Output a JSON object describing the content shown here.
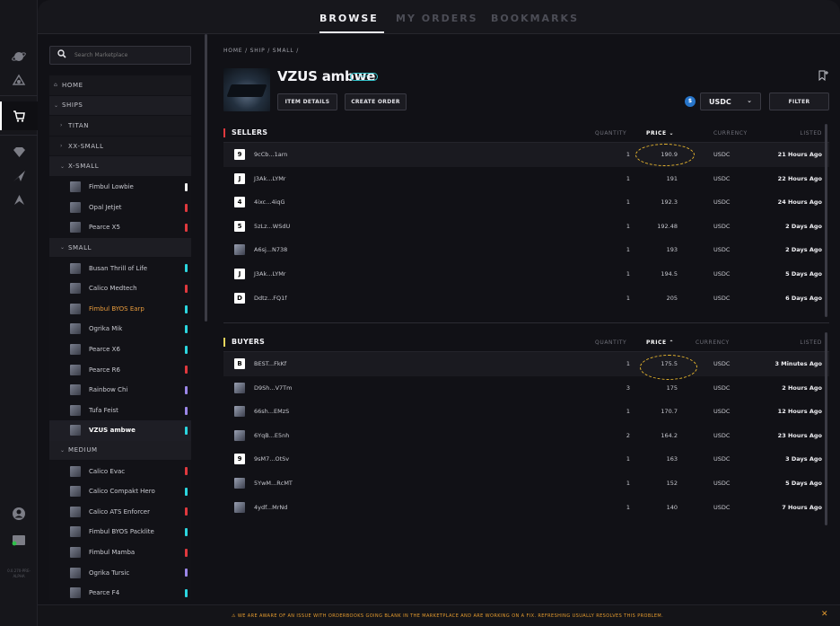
{
  "nav_tabs": [
    "BROWSE",
    "MY ORDERS",
    "BOOKMARKS"
  ],
  "search": {
    "placeholder": "Search Marketplace"
  },
  "rail": {
    "icons": [
      "planet-icon",
      "radar-icon",
      "cart-icon",
      "diamond-icon",
      "ship-icon",
      "logo-icon",
      "profile-icon",
      "wallet-icon"
    ],
    "version": "0.0.270-PRE-ALPHA"
  },
  "sidebar": {
    "home": "HOME",
    "ships": "SHIPS",
    "titan": "TITAN",
    "xx_small": "XX-SMALL",
    "x_small": "X-SMALL",
    "x_small_items": [
      {
        "label": "Fimbul Lowbie",
        "color": "#f2f2f2"
      },
      {
        "label": "Opal Jetjet",
        "color": "#e0393e"
      },
      {
        "label": "Pearce X5",
        "color": "#e0393e"
      }
    ],
    "small": "SMALL",
    "small_items": [
      {
        "label": "Busan Thrill of Life",
        "color": "#2bd6df"
      },
      {
        "label": "Calico Medtech",
        "color": "#e0393e"
      },
      {
        "label": "Fimbul BYOS Earp",
        "color": "#2bd6df"
      },
      {
        "label": "Ogrika Mik",
        "color": "#2bd6df"
      },
      {
        "label": "Pearce X6",
        "color": "#2bd6df"
      },
      {
        "label": "Pearce R6",
        "color": "#e0393e"
      },
      {
        "label": "Rainbow Chi",
        "color": "#9b86e8"
      },
      {
        "label": "Tufa Feist",
        "color": "#9b86e8"
      },
      {
        "label": "VZUS ambwe",
        "color": "#2bd6df"
      }
    ],
    "medium": "MEDIUM",
    "medium_items": [
      {
        "label": "Calico Evac",
        "color": "#e0393e"
      },
      {
        "label": "Calico Compakt Hero",
        "color": "#2bd6df"
      },
      {
        "label": "Calico ATS Enforcer",
        "color": "#e0393e"
      },
      {
        "label": "Fimbul BYOS Packlite",
        "color": "#2bd6df"
      },
      {
        "label": "Fimbul Mamba",
        "color": "#e0393e"
      },
      {
        "label": "Ogrika Tursic",
        "color": "#9b86e8"
      },
      {
        "label": "Pearce F4",
        "color": "#2bd6df"
      }
    ]
  },
  "main": {
    "breadcrumb": "HOME / SHIP / SMALL /",
    "title": "VZUS ambwe",
    "rarity": "RARE",
    "item_details": "ITEM DETAILS",
    "create_order": "CREATE ORDER",
    "currency": "USDC",
    "filter": "FILTER"
  },
  "columns": {
    "quantity": "QUANTITY",
    "price": "PRICE",
    "currency": "CURRENCY",
    "listed": "LISTED"
  },
  "sellers": {
    "title": "SELLERS",
    "rows": [
      {
        "avatar": "9",
        "name": "9cCb...1arn",
        "qty": "1",
        "price": "190.9",
        "cur": "USDC",
        "time": "21 Hours Ago"
      },
      {
        "avatar": "J",
        "name": "J3Ak...LYMr",
        "qty": "1",
        "price": "191",
        "cur": "USDC",
        "time": "22 Hours Ago"
      },
      {
        "avatar": "4",
        "name": "4ixc...4iqG",
        "qty": "1",
        "price": "192.3",
        "cur": "USDC",
        "time": "24 Hours Ago"
      },
      {
        "avatar": "5",
        "name": "5zLz...WSdU",
        "qty": "1",
        "price": "192.48",
        "cur": "USDC",
        "time": "2 Days Ago"
      },
      {
        "avatar": "",
        "name": "A6sj...N738",
        "qty": "1",
        "price": "193",
        "cur": "USDC",
        "time": "2 Days Ago"
      },
      {
        "avatar": "J",
        "name": "J3Ak...LYMr",
        "qty": "1",
        "price": "194.5",
        "cur": "USDC",
        "time": "5 Days Ago"
      },
      {
        "avatar": "D",
        "name": "Ddtz...FQ1f",
        "qty": "1",
        "price": "205",
        "cur": "USDC",
        "time": "6 Days Ago"
      }
    ]
  },
  "buyers": {
    "title": "BUYERS",
    "rows": [
      {
        "avatar": "B",
        "name": "BEST...FkKf",
        "qty": "1",
        "price": "175.5",
        "cur": "USDC",
        "time": "3 Minutes Ago"
      },
      {
        "avatar": "",
        "name": "D9Sh...V7Tm",
        "qty": "3",
        "price": "175",
        "cur": "USDC",
        "time": "2 Hours Ago"
      },
      {
        "avatar": "",
        "name": "66sh...EMzS",
        "qty": "1",
        "price": "170.7",
        "cur": "USDC",
        "time": "12 Hours Ago"
      },
      {
        "avatar": "",
        "name": "6YqB...E5nh",
        "qty": "2",
        "price": "164.2",
        "cur": "USDC",
        "time": "23 Hours Ago"
      },
      {
        "avatar": "9",
        "name": "9sM7...OtSv",
        "qty": "1",
        "price": "163",
        "cur": "USDC",
        "time": "3 Days Ago"
      },
      {
        "avatar": "",
        "name": "5YwM...RcMT",
        "qty": "1",
        "price": "152",
        "cur": "USDC",
        "time": "5 Days Ago"
      },
      {
        "avatar": "",
        "name": "4ydf...MrNd",
        "qty": "1",
        "price": "140",
        "cur": "USDC",
        "time": "7 Hours Ago"
      }
    ]
  },
  "banner": {
    "text": "WE ARE AWARE OF AN ISSUE WITH ORDERBOOKS GOING BLANK IN THE MARKETPLACE AND ARE WORKING ON A FIX. REFRESHING USUALLY RESOLVES THIS PROBLEM."
  }
}
